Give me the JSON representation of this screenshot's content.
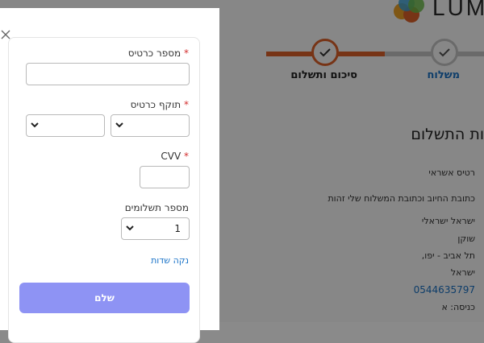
{
  "background": {
    "logo_text": "LUM",
    "steps": [
      {
        "label": "סיכום ותשלום"
      },
      {
        "label": "משלוח"
      }
    ],
    "heading": "ות התשלום",
    "lines": [
      "רטיס אשראי",
      "כתובת החיוב וכתובת המשלוח שלי זהות",
      "ישראל ישראלי",
      "שוקן",
      "תל אביב - יפו,",
      "ישראל",
      "0544635797",
      "כניסה: א"
    ]
  },
  "modal": {
    "close_label": "×",
    "card_number": {
      "label": "מספר כרטיס",
      "required_mark": "*",
      "value": ""
    },
    "expiry": {
      "label": "תוקף כרטיס",
      "required_mark": "*",
      "month_value": "",
      "year_value": ""
    },
    "cvv": {
      "label": "CVV",
      "required_mark": "*",
      "value": ""
    },
    "installments": {
      "label": "מספר תשלומים",
      "value": "1"
    },
    "clear_fields": "נקה שדות",
    "pay_button": "שלם"
  },
  "colors": {
    "accent_orange": "#e0632a",
    "link_blue": "#1a73c8",
    "pay_button": "#8e93f4",
    "required_red": "#d32f2f"
  }
}
